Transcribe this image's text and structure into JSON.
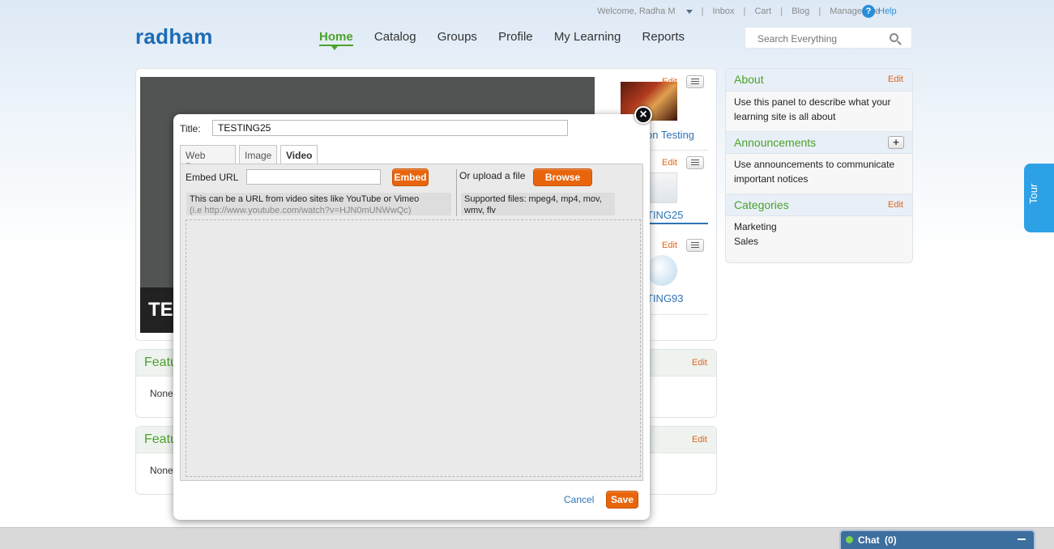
{
  "header": {
    "welcome": "Welcome, Radha M",
    "links": [
      "Inbox",
      "Cart",
      "Blog",
      "Manage Site"
    ],
    "help": "Help",
    "logo": "radham",
    "nav": [
      "Home",
      "Catalog",
      "Groups",
      "Profile",
      "My Learning",
      "Reports"
    ],
    "active_nav": "Home",
    "search_placeholder": "Search Everything"
  },
  "main": {
    "hero_caption": "TE",
    "side_items": [
      {
        "edit": "Edit",
        "label": "on Testing"
      },
      {
        "edit": "Edit",
        "label": "TING25"
      },
      {
        "edit": "Edit",
        "label": "TING93"
      }
    ],
    "featured": [
      {
        "title": "Featu",
        "edit": "Edit",
        "body": "None"
      },
      {
        "title": "Featu",
        "edit": "Edit",
        "body": "None"
      }
    ]
  },
  "right": {
    "about": {
      "title": "About",
      "edit": "Edit",
      "body": "Use this panel to describe what your learning site is all about"
    },
    "announcements": {
      "title": "Announcements",
      "body": "Use announcements to communicate important notices"
    },
    "categories": {
      "title": "Categories",
      "edit": "Edit",
      "items": [
        "Marketing",
        "Sales"
      ]
    }
  },
  "tour": "Tour",
  "chat": {
    "label": "Chat",
    "count": "(0)"
  },
  "modal": {
    "title_label": "Title:",
    "title_value": "TESTING25",
    "tabs": [
      "Web Page",
      "Image",
      "Video"
    ],
    "active_tab": "Video",
    "embed_label": "Embed URL",
    "embed_button": "Embed",
    "hint": "This can be a URL from video sites like YouTube or Vimeo",
    "hint_example": "(i.e http://www.youtube.com/watch?v=HJN0mUNWwQc)",
    "upload_label": "Or upload a file",
    "browse_button": "Browse",
    "supported": "Supported files: mpeg4, mp4, mov, wmv, flv",
    "cancel": "Cancel",
    "save": "Save"
  },
  "colors": {
    "brand_blue": "#1c6bb5",
    "accent_green": "#4ca22b",
    "edit_orange": "#e0651b",
    "button_orange": "#e8650c",
    "tour_blue": "#2da1e6",
    "chat_bar": "#3c6e9e"
  }
}
